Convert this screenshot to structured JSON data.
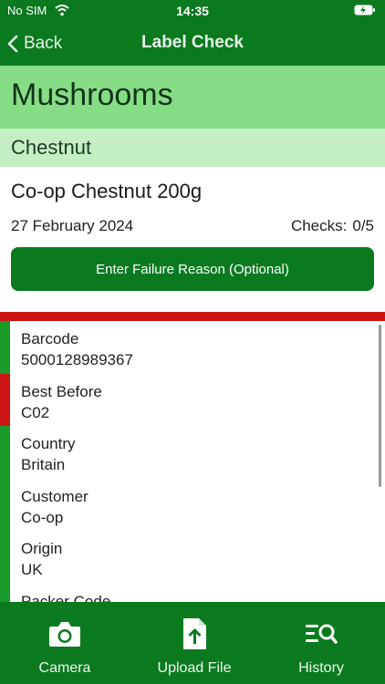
{
  "status": {
    "carrier": "No SIM",
    "time": "14:35"
  },
  "nav": {
    "back_label": "Back",
    "title": "Label Check"
  },
  "category": "Mushrooms",
  "subcategory": "Chestnut",
  "product": {
    "name": "Co-op Chestnut 200g",
    "date": "27 February 2024",
    "checks_label": "Checks:",
    "checks_value": "0/5"
  },
  "failure_button": "Enter Failure Reason (Optional)",
  "fields": [
    {
      "label": "Barcode",
      "value": "5000128989367",
      "status_color": "#1a9a2a"
    },
    {
      "label": "Best Before",
      "value": "C02",
      "status_color": "#cc1515"
    },
    {
      "label": "Country",
      "value": "Britain",
      "status_color": "#1a9a2a"
    },
    {
      "label": "Customer",
      "value": "Co-op",
      "status_color": "#1a9a2a"
    },
    {
      "label": "Origin",
      "value": "UK",
      "status_color": "#1a9a2a"
    },
    {
      "label": "Packer Code",
      "value": "",
      "status_color": "#1a9a2a"
    }
  ],
  "tabs": {
    "camera": "Camera",
    "upload": "Upload File",
    "history": "History"
  },
  "colors": {
    "primary": "#0b7a1f",
    "category_bg": "#87dd85",
    "subcategory_bg": "#c4efc3",
    "fail": "#cc1515",
    "pass": "#1a9a2a"
  }
}
